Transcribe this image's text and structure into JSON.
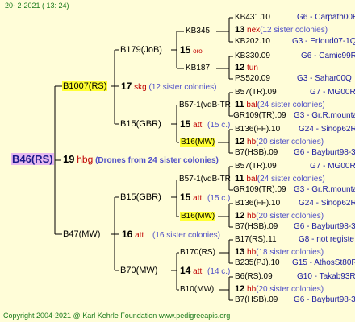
{
  "header": "20-  2-2021 ( 13: 24)",
  "footer": "Copyright 2004-2021 @ Karl Kehrle Foundation     www.pedigreeapis.org",
  "root": {
    "name": "B46(RS)",
    "num": "19",
    "code": "hbg",
    "info": "(Drones from 24 sister colonies)"
  },
  "g1": [
    {
      "name": "B1007(RS)",
      "num": "17",
      "code": "skg",
      "info": "(12 sister colonies)"
    },
    {
      "name": "B47(MW)",
      "num": "16",
      "code": "att",
      "info": "(16 sister colonies)"
    }
  ],
  "g2": [
    {
      "name": "B179(JoB)",
      "num": "15",
      "code": "oro",
      "info": ""
    },
    {
      "name": "B15(GBR)",
      "num": "15",
      "code": "att",
      "info": "(15 c.)"
    },
    {
      "name": "B15(GBR)",
      "num": "15",
      "code": "att",
      "info": "(15 c.)"
    },
    {
      "name": "B70(MW)",
      "num": "14",
      "code": "att",
      "info": "(14 c.)"
    }
  ],
  "g3": [
    {
      "name": "KB345"
    },
    {
      "name": "KB187"
    },
    {
      "name": "B57-1(vdB-TR"
    },
    {
      "name": "B16(MW)"
    },
    {
      "name": "B57-1(vdB-TR"
    },
    {
      "name": "B16(MW)"
    },
    {
      "name": "B170(RS)"
    },
    {
      "name": "B10(MW)"
    }
  ],
  "g4": [
    {
      "name": "KB431.10",
      "right": "G6 - Carpath00R"
    },
    {
      "num": "13",
      "code": "nex",
      "info": "(12 sister colonies)"
    },
    {
      "name": "KB202.10",
      "right": "G3 - Erfoud07-1Q"
    },
    {
      "name": "KB330.09",
      "right": "G6 - Camic99R"
    },
    {
      "num": "12",
      "code": "tun",
      "info": ""
    },
    {
      "name": "PS520.09",
      "right": "G3 - Sahar00Q"
    },
    {
      "name": "B57(TR).09",
      "right": "G7 - MG00R"
    },
    {
      "num": "11",
      "code": "bal",
      "info": "(24 sister colonies)"
    },
    {
      "name": "GR109(TR).09",
      "right": "G3 - Gr.R.mounta"
    },
    {
      "name": "B136(FF).10",
      "right": "G24 - Sinop62R"
    },
    {
      "num": "12",
      "code": "hb",
      "info": "(20 sister colonies)"
    },
    {
      "name": "B7(HSB).09",
      "right": "G6 - Bayburt98-3"
    },
    {
      "name": "B57(TR).09",
      "right": "G7 - MG00R"
    },
    {
      "num": "11",
      "code": "bal",
      "info": "(24 sister colonies)"
    },
    {
      "name": "GR109(TR).09",
      "right": "G3 - Gr.R.mounta"
    },
    {
      "name": "B136(FF).10",
      "right": "G24 - Sinop62R"
    },
    {
      "num": "12",
      "code": "hb",
      "info": "(20 sister colonies)"
    },
    {
      "name": "B7(HSB).09",
      "right": "G6 - Bayburt98-3"
    },
    {
      "name": "B17(RS).11",
      "right": "G8 - not registe"
    },
    {
      "num": "13",
      "code": "hb",
      "info": "(18 sister colonies)"
    },
    {
      "name": "B235(PJ).10",
      "right": "G15 - AthosSt80R"
    },
    {
      "name": "B6(RS).09",
      "right": "G10 - Takab93R"
    },
    {
      "num": "12",
      "code": "hb",
      "info": "(20 sister colonies)"
    },
    {
      "name": "B7(HSB).09",
      "right": "G6 - Bayburt98-3"
    }
  ],
  "colors": {
    "background": "#fffdd8",
    "highlight": "#ffff33",
    "root_bg": "#e6b8f0",
    "code": "#c00000",
    "info": "#1a1aa0"
  }
}
